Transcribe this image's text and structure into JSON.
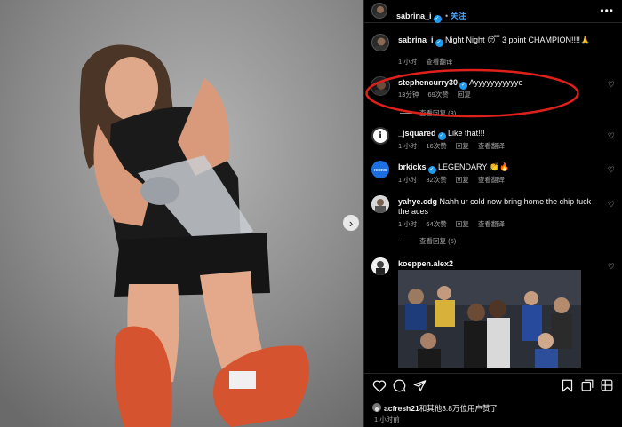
{
  "post": {
    "author": "sabrina_i",
    "follow_label": "关注",
    "more_icon": "more-horizontal-icon",
    "image_alt_icon": "chevron-right-icon"
  },
  "caption": {
    "username": "sabrina_i",
    "text": "Night Night 😴 3 point CHAMPION!!!!🙏",
    "time": "1 小时",
    "translate": "查看翻译"
  },
  "comments": [
    {
      "username": "stephencurry30",
      "verified": true,
      "text": "Ayyyyyyyyyyye",
      "time": "13分钟",
      "likes": "69次赞",
      "reply": "回复",
      "replies": "查看回复 (3)"
    },
    {
      "username": "_jsquared",
      "verified": true,
      "text": "Like that!!!",
      "time": "1 小时",
      "likes": "16次赞",
      "reply": "回复",
      "translate": "查看翻译"
    },
    {
      "username": "brkicks",
      "verified": true,
      "text": "LEGENDARY 👏🔥",
      "time": "1 小时",
      "likes": "32次赞",
      "reply": "回复",
      "translate": "查看翻译"
    },
    {
      "username": "yahye.cdg",
      "verified": false,
      "text": "Nahh ur cold now bring home the chip fuck the aces",
      "time": "1 小时",
      "likes": "64次赞",
      "reply": "回复",
      "translate": "查看翻译",
      "replies": "查看回复 (5)"
    },
    {
      "username": "koeppen.alex2",
      "verified": false,
      "text": ""
    }
  ],
  "footer": {
    "liked_by_user": "acfresh21",
    "liked_by_rest": "和其他3.8万位用户赞了",
    "time": "1 小时前"
  },
  "colors": {
    "accent": "#4fa8ff",
    "verified": "#1d9bf0",
    "highlight_ring": "#e0201b"
  }
}
